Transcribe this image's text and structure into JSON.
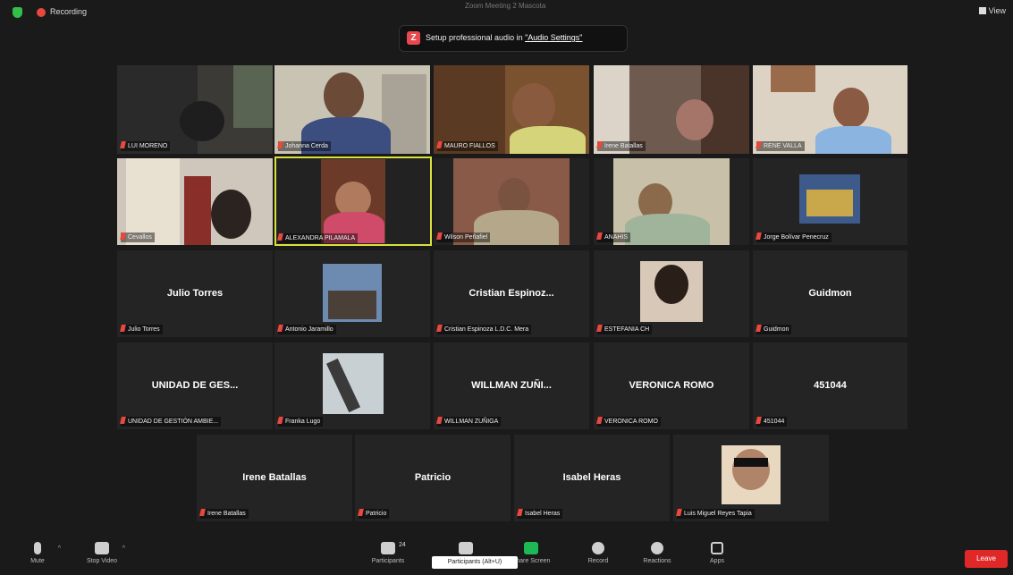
{
  "recording": {
    "label": "Recording"
  },
  "meeting_title": "Zoom Meeting 2 Mascota",
  "view_label": "View",
  "notice": {
    "prefix": "Setup professional audio in ",
    "link": "\"Audio Settings\""
  },
  "participants": [
    {
      "label": "LUI MORENO",
      "center": ""
    },
    {
      "label": "Johanna Cerda",
      "center": ""
    },
    {
      "label": "MAURO FIALLOS",
      "center": ""
    },
    {
      "label": "Irene Batallas",
      "center": ""
    },
    {
      "label": "RENE VALLA",
      "center": ""
    },
    {
      "label": "Cevallos",
      "center": ""
    },
    {
      "label": "ALEXANDRA PILAMALA",
      "center": ""
    },
    {
      "label": "Wilson Peñafiel",
      "center": ""
    },
    {
      "label": "ANAHIS",
      "center": ""
    },
    {
      "label": "Jorge Bolívar Penecruz",
      "center": ""
    },
    {
      "label": "Julio Torres",
      "center": "Julio Torres"
    },
    {
      "label": "Antonio Jaramillo",
      "center": ""
    },
    {
      "label": "Cristian Espinoza L.D.C. Mera",
      "center": "Cristian  Espinoz..."
    },
    {
      "label": "ESTEFANIA CH",
      "center": ""
    },
    {
      "label": "Guidmon",
      "center": "Guidmon"
    },
    {
      "label": "UNIDAD DE GESTIÓN AMBIE...",
      "center": "UNIDAD DE GES..."
    },
    {
      "label": "Franka Lugo",
      "center": ""
    },
    {
      "label": "WILLMAN ZUÑIGA",
      "center": "WILLMAN ZUÑI..."
    },
    {
      "label": "VERONICA ROMO",
      "center": "VERONICA ROMO"
    },
    {
      "label": "451044",
      "center": "451044"
    },
    {
      "label": "Irene Batallas",
      "center": "Irene Batallas"
    },
    {
      "label": "Patricio",
      "center": "Patricio"
    },
    {
      "label": "Isabel Heras",
      "center": "Isabel Heras"
    },
    {
      "label": "Luis Miguel Reyes Tapia",
      "center": ""
    }
  ],
  "toolbar": {
    "mute": "Mute",
    "stop_video": "Stop Video",
    "participants": "Participants",
    "participants_count": "24",
    "share": "Share Screen",
    "record": "Record",
    "reactions": "Reactions",
    "apps": "Apps",
    "leave": "Leave",
    "tooltip": "Participants (Alt+U)"
  },
  "colors": {
    "active_speaker": "#d9e23a",
    "leave": "#e02828",
    "muted": "#e8483e"
  }
}
